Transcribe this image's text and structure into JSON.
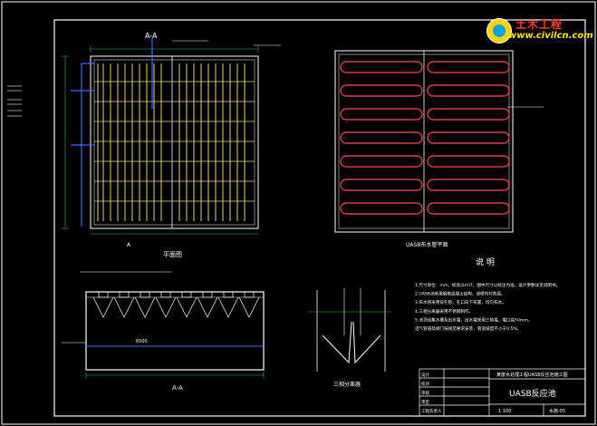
{
  "watermark": {
    "cn": "土木工程",
    "url": "www.civilcn.com"
  },
  "plan_left": {
    "title": "平面图",
    "section_mark": "A-A"
  },
  "plan_right": {
    "title": "UASB布水管平面"
  },
  "section_bottom": {
    "title": "A-A",
    "dim_text": "6500"
  },
  "detail": {
    "title": "三相分离器"
  },
  "notes": {
    "heading": "说 明",
    "lines": [
      "1.尺寸单位：mm，标高以m计，图中尺寸以标注为准，设计参数详见说明书。",
      "2.UASB池采用钢筋混凝土结构，池壁内衬防腐。",
      "3.布水管采用穿孔管，孔口向下布置，均匀布水。",
      "4.三相分离器采用不锈钢制作。",
      "5.池顶设集水槽及出水堰，出水堰采用三角堰，堰口高50mm。",
      "  沼气管道及阀门按规范要求安装，管道坡度不小于0.5%。"
    ]
  },
  "title_block": {
    "project": "某废水处理工程UASB反应池施工图",
    "drawing": "UASB反应池",
    "rows": [
      "设计",
      "校对",
      "审核",
      "审定",
      "工程负责人"
    ],
    "scale_label": "1:100",
    "sheet_label": "水施-05"
  }
}
